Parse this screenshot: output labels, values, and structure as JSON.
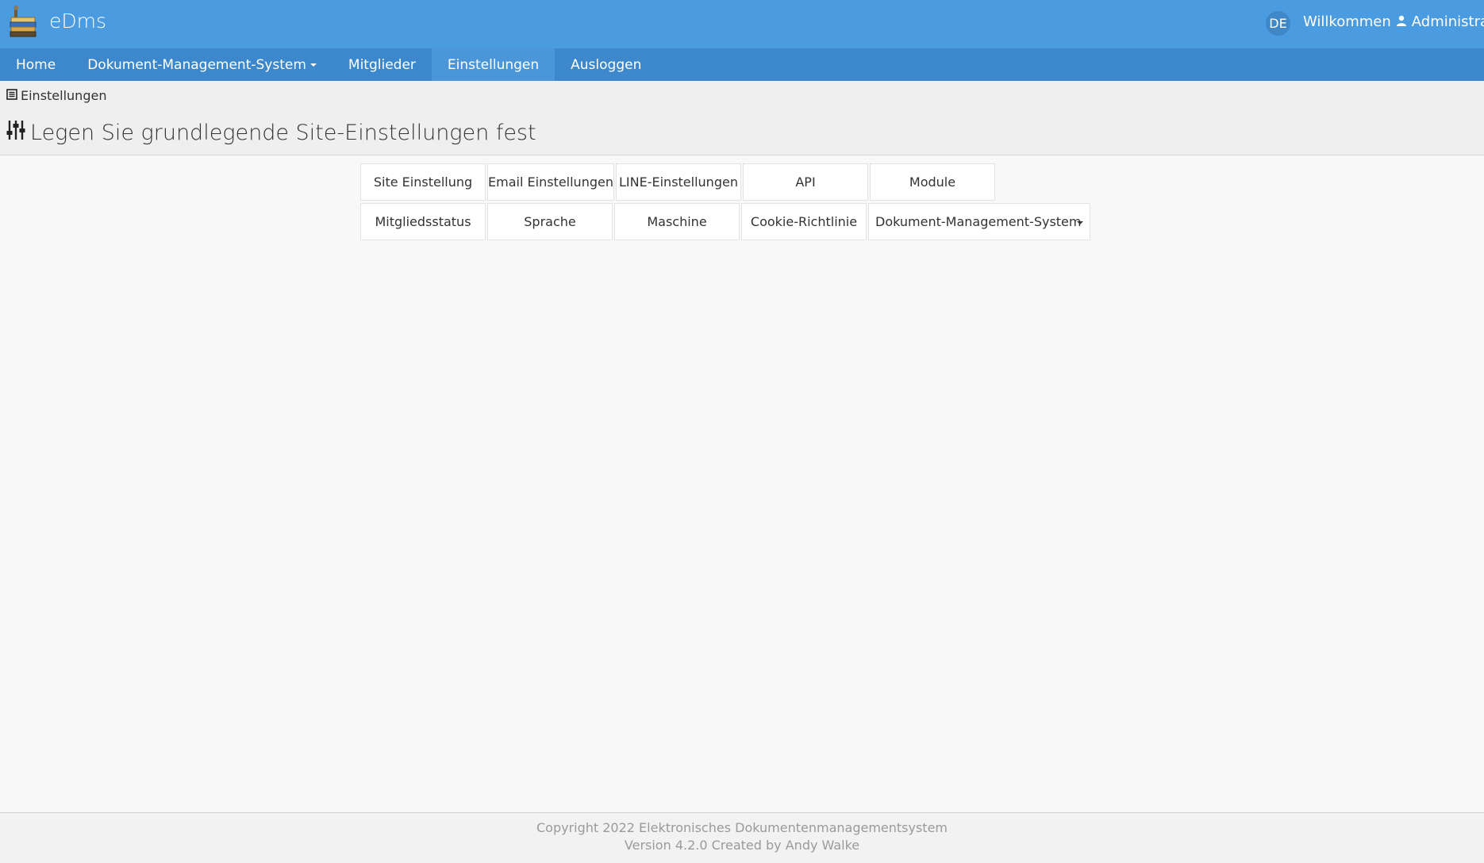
{
  "app": {
    "brand": "eDms",
    "language": "DE",
    "welcome_label": "Willkommen",
    "user_name": "Administrator"
  },
  "nav": {
    "items": [
      {
        "label": "Home"
      },
      {
        "label": "Dokument-Management-System"
      },
      {
        "label": "Mitglieder"
      },
      {
        "label": "Einstellungen"
      },
      {
        "label": "Ausloggen"
      }
    ]
  },
  "breadcrumb": {
    "label": "Einstellungen"
  },
  "page": {
    "title": "Legen Sie grundlegende Site-Einstellungen fest"
  },
  "settings_buttons": {
    "row1": [
      "Site Einstellung",
      "Email Einstellungen",
      "LINE-Einstellungen",
      "API",
      "Module"
    ],
    "row2": [
      "Mitgliedsstatus",
      "Sprache",
      "Maschine",
      "Cookie-Richtlinie",
      "Dokument-Management-System"
    ]
  },
  "footer": {
    "copyright": "Copyright 2022 Elektronisches Dokumentenmanagementsystem",
    "version": "Version 4.2.0 Created by Andy Walke"
  },
  "colors": {
    "topbar": "#4a9bdf",
    "navbar": "#3d88cc",
    "nav_active": "#4b96d8",
    "page_bg": "#f8f8f8"
  }
}
